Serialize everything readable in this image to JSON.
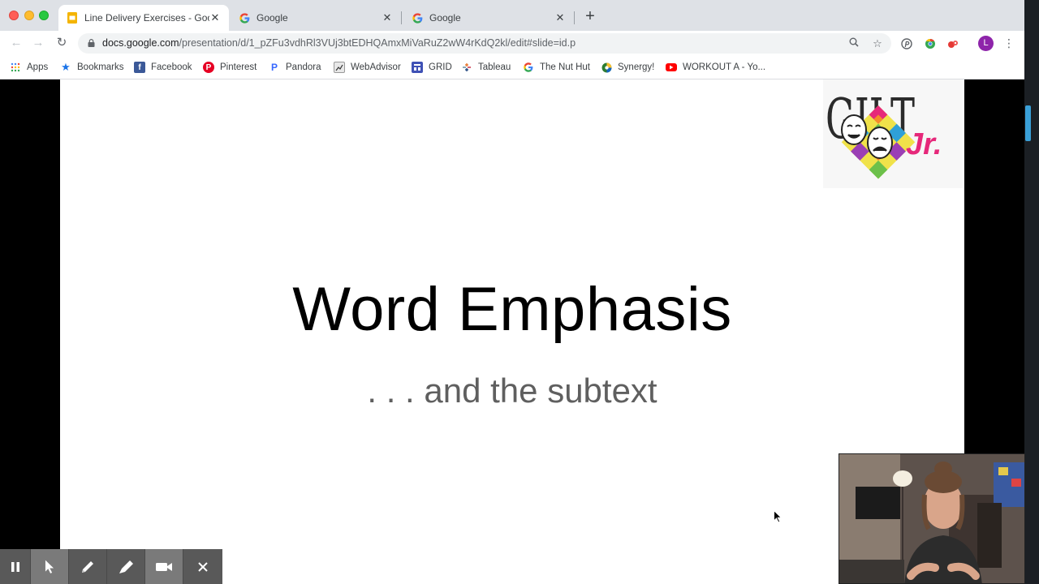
{
  "browser": {
    "tabs": [
      {
        "title": "Line Delivery Exercises - Goog",
        "active": true,
        "icon": "slides-icon"
      },
      {
        "title": "Google",
        "active": false,
        "icon": "google-icon"
      },
      {
        "title": "Google",
        "active": false,
        "icon": "google-icon"
      }
    ],
    "new_tab_label": "+",
    "close_tab_label": "✕",
    "address": {
      "host": "docs.google.com",
      "path": "/presentation/d/1_pZFu3vdhRl3VUj3btEDHQAmxMiVaRuZ2wW4rKdQ2kl/edit#slide=id.p"
    },
    "profile_initial": "L"
  },
  "bookmarks": [
    {
      "label": "Apps",
      "icon": "apps-grid-icon"
    },
    {
      "label": "Bookmarks",
      "icon": "star-icon"
    },
    {
      "label": "Facebook",
      "icon": "facebook-icon"
    },
    {
      "label": "Pinterest",
      "icon": "pinterest-icon"
    },
    {
      "label": "Pandora",
      "icon": "pandora-icon"
    },
    {
      "label": "WebAdvisor",
      "icon": "webadvisor-icon"
    },
    {
      "label": "GRID",
      "icon": "grid-icon"
    },
    {
      "label": "Tableau",
      "icon": "tableau-icon"
    },
    {
      "label": "The Nut Hut",
      "icon": "google-icon"
    },
    {
      "label": "Synergy!",
      "icon": "synergy-icon"
    },
    {
      "label": "WORKOUT A - Yo...",
      "icon": "youtube-icon"
    }
  ],
  "slide": {
    "title": "Word Emphasis",
    "subtitle": ". . . and the subtext",
    "logo_main": "GILT",
    "logo_suffix": "Jr."
  },
  "recording_toolbar": {
    "buttons": [
      "pause-icon",
      "pointer-icon",
      "pen-icon",
      "highlighter-icon",
      "camera-icon",
      "close-icon"
    ]
  },
  "colors": {
    "profile": "#8e24aa",
    "logo_pink": "#e6287a"
  }
}
